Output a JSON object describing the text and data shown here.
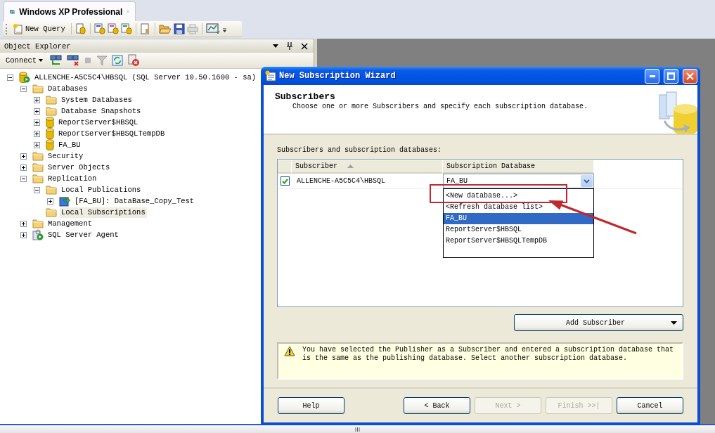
{
  "tab": {
    "title": "Windows XP Professional"
  },
  "toolbar": {
    "new_query": "New Query"
  },
  "object_explorer": {
    "title": "Object Explorer",
    "connect": "Connect",
    "tree": [
      {
        "label": "ALLENCHE-A5C5C4\\HBSQL (SQL Server 10.50.1600 - sa)",
        "kind": "server",
        "expanded": true,
        "selected": false,
        "children": [
          {
            "label": "Databases",
            "kind": "folder",
            "expanded": true,
            "selected": false,
            "children": [
              {
                "label": "System Databases",
                "kind": "folder",
                "expanded": false,
                "selected": false
              },
              {
                "label": "Database Snapshots",
                "kind": "folder",
                "expanded": false,
                "selected": false
              },
              {
                "label": "ReportServer$HBSQL",
                "kind": "database",
                "expanded": false,
                "selected": false
              },
              {
                "label": "ReportServer$HBSQLTempDB",
                "kind": "database",
                "expanded": false,
                "selected": false
              },
              {
                "label": "FA_BU",
                "kind": "database",
                "expanded": false,
                "selected": false
              }
            ]
          },
          {
            "label": "Security",
            "kind": "folder",
            "expanded": false,
            "selected": false
          },
          {
            "label": "Server Objects",
            "kind": "folder",
            "expanded": false,
            "selected": false
          },
          {
            "label": "Replication",
            "kind": "folder",
            "expanded": true,
            "selected": false,
            "children": [
              {
                "label": "Local Publications",
                "kind": "folder",
                "expanded": true,
                "selected": false,
                "children": [
                  {
                    "label": "[FA_BU]: DataBase_Copy_Test",
                    "kind": "publication",
                    "expanded": false,
                    "selected": false
                  }
                ]
              },
              {
                "label": "Local Subscriptions",
                "kind": "folder",
                "selected": true
              }
            ]
          },
          {
            "label": "Management",
            "kind": "folder",
            "expanded": false,
            "selected": false
          },
          {
            "label": "SQL Server Agent",
            "kind": "agent",
            "expanded": false,
            "selected": false
          }
        ]
      }
    ]
  },
  "wizard": {
    "title": "New Subscription Wizard",
    "heading": "Subscribers",
    "subheading": "Choose one or more Subscribers and specify each subscription database.",
    "grid_label": "Subscribers and subscription databases:",
    "columns": [
      {
        "label": "Subscriber",
        "sorted": true
      },
      {
        "label": "Subscription Database",
        "sorted": false
      }
    ],
    "rows": [
      {
        "checked": true,
        "subscriber": "ALLENCHE-A5C5C4\\HBSQL",
        "database": "FA_BU"
      }
    ],
    "dropdown": [
      {
        "label": "<New database...>",
        "selected": false
      },
      {
        "label": "<Refresh database list>",
        "selected": false
      },
      {
        "label": "FA_BU",
        "selected": true
      },
      {
        "label": "ReportServer$HBSQL",
        "selected": false
      },
      {
        "label": "ReportServer$HBSQLTempDB",
        "selected": false
      }
    ],
    "add_button": "Add Subscriber",
    "warning": "You have selected the Publisher as a Subscriber and entered a subscription database that is the same as the publishing database. Select another subscription database.",
    "buttons": [
      {
        "label": "Help",
        "disabled": false
      },
      {
        "label": "< Back",
        "disabled": false
      },
      {
        "label": "Next >",
        "disabled": true
      },
      {
        "label": "Finish >>|",
        "disabled": true
      },
      {
        "label": "Cancel",
        "disabled": false
      }
    ]
  }
}
